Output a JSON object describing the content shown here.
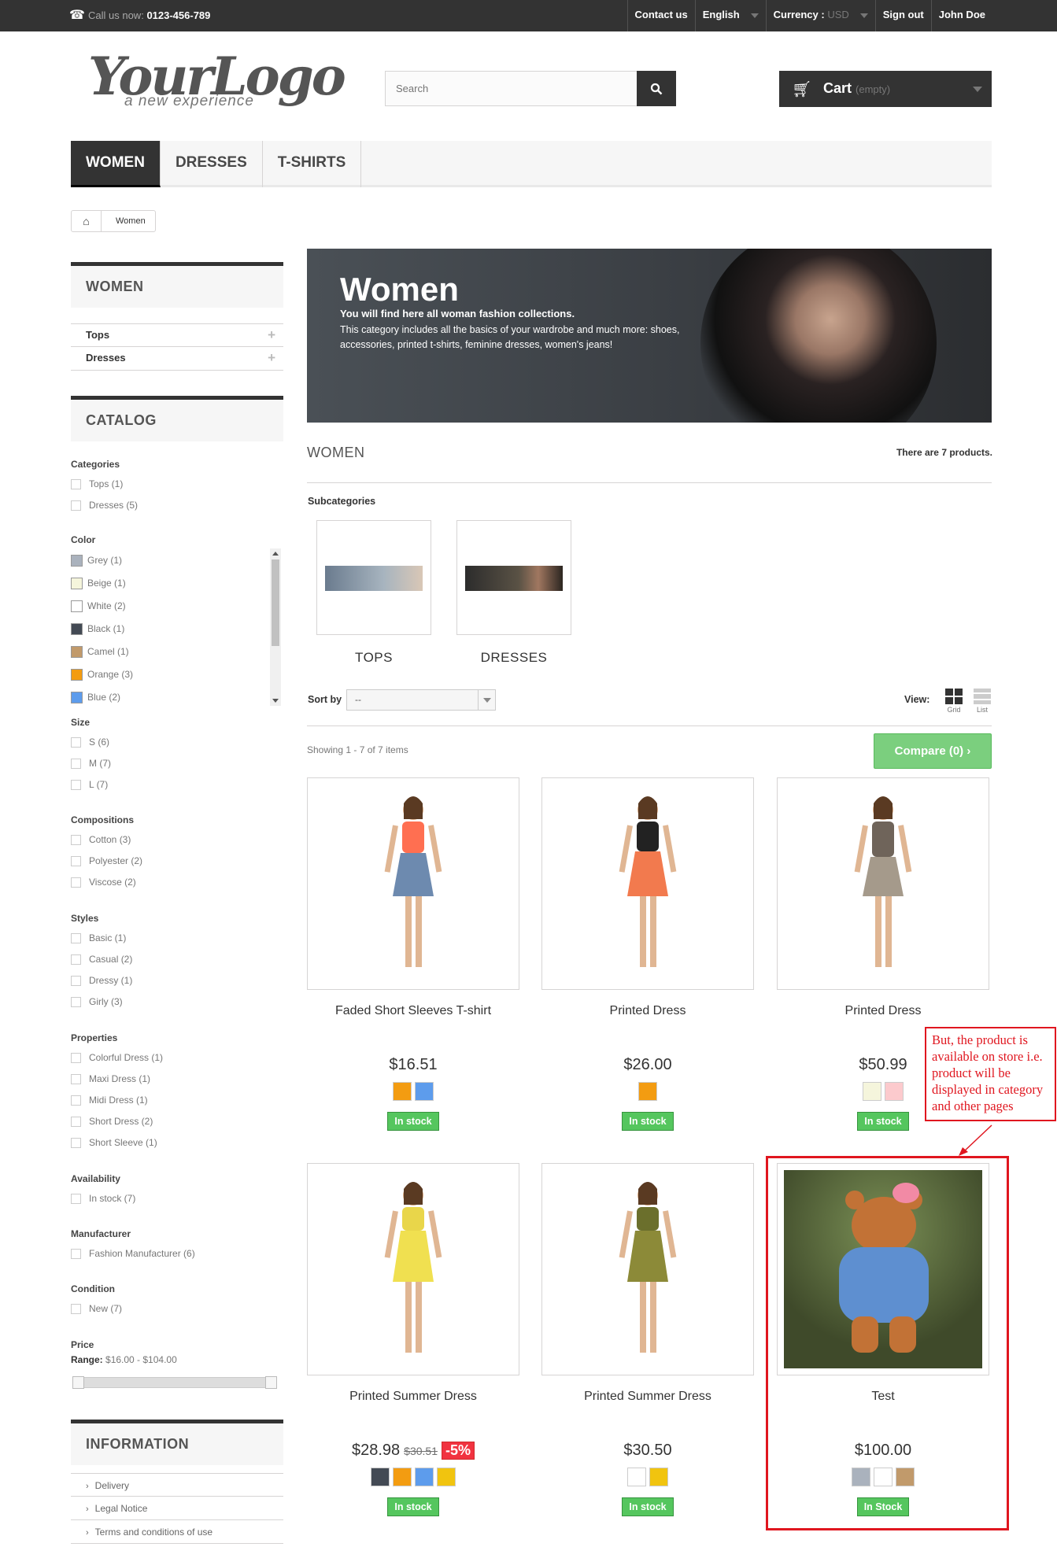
{
  "topbar": {
    "call_label": "Call us now:",
    "phone": "0123-456-789",
    "links": [
      "Contact us",
      "English",
      "Currency :",
      "Sign out",
      "John Doe"
    ],
    "currency_value": "USD"
  },
  "logo": {
    "main": "YourLogo",
    "tagline": "a new experience"
  },
  "search": {
    "placeholder": "Search"
  },
  "cart": {
    "label": "Cart",
    "status": "(empty)"
  },
  "menu": [
    "WOMEN",
    "DRESSES",
    "T-SHIRTS"
  ],
  "breadcrumb": {
    "current": "Women"
  },
  "left": {
    "category_block_title": "WOMEN",
    "category_items": [
      "Tops",
      "Dresses"
    ],
    "catalog_title": "CATALOG",
    "filters": {
      "categories": {
        "title": "Categories",
        "items": [
          "Tops (1)",
          "Dresses (5)"
        ]
      },
      "color": {
        "title": "Color",
        "items": [
          {
            "label": "Grey (1)",
            "color": "#AAB2BD"
          },
          {
            "label": "Beige (1)",
            "color": "#f5f5dc"
          },
          {
            "label": "White (2)",
            "color": "#ffffff"
          },
          {
            "label": "Black (1)",
            "color": "#434A54"
          },
          {
            "label": "Camel (1)",
            "color": "#C19A6B"
          },
          {
            "label": "Orange (3)",
            "color": "#F39C11"
          },
          {
            "label": "Blue (2)",
            "color": "#5D9CEC"
          }
        ]
      },
      "size": {
        "title": "Size",
        "items": [
          "S (6)",
          "M (7)",
          "L (7)"
        ]
      },
      "compositions": {
        "title": "Compositions",
        "items": [
          "Cotton (3)",
          "Polyester (2)",
          "Viscose (2)"
        ]
      },
      "styles": {
        "title": "Styles",
        "items": [
          "Basic (1)",
          "Casual (2)",
          "Dressy (1)",
          "Girly (3)"
        ]
      },
      "properties": {
        "title": "Properties",
        "items": [
          "Colorful Dress (1)",
          "Maxi Dress (1)",
          "Midi Dress (1)",
          "Short Dress (2)",
          "Short Sleeve (1)"
        ]
      },
      "availability": {
        "title": "Availability",
        "items": [
          "In stock (7)"
        ]
      },
      "manufacturer": {
        "title": "Manufacturer",
        "items": [
          "Fashion Manufacturer (6)"
        ]
      },
      "condition": {
        "title": "Condition",
        "items": [
          "New (7)"
        ]
      },
      "price": {
        "title": "Price",
        "range_label": "Range:",
        "range_value": "$16.00 - $104.00"
      }
    },
    "info_title": "INFORMATION",
    "info_items": [
      "Delivery",
      "Legal Notice",
      "Terms and conditions of use"
    ]
  },
  "banner": {
    "title": "Women",
    "line1": "You will find here all woman fashion collections.",
    "line2": "This category includes all the basics of your wardrobe and much more: shoes, accessories, printed t-shirts, feminine dresses, women's jeans!"
  },
  "category": {
    "heading": "WOMEN",
    "count": "There are 7 products.",
    "subcategories_title": "Subcategories",
    "subcategories": [
      "TOPS",
      "DRESSES"
    ],
    "sort_label": "Sort by",
    "sort_value": "--",
    "view_label": "View:",
    "view_grid": "Grid",
    "view_list": "List",
    "showing": "Showing 1 - 7 of 7 items",
    "compare": "Compare (0)"
  },
  "products": [
    {
      "name": "Faded Short Sleeves T-shirt",
      "price": "$16.51",
      "old_price": "",
      "discount": "",
      "colors": [
        "#F39C11",
        "#5D9CEC"
      ],
      "stock": "In stock"
    },
    {
      "name": "Printed Dress",
      "price": "$26.00",
      "old_price": "",
      "discount": "",
      "colors": [
        "#F39C11"
      ],
      "stock": "In stock"
    },
    {
      "name": "Printed Dress",
      "price": "$50.99",
      "old_price": "",
      "discount": "",
      "colors": [
        "#f5f5dc",
        "#FCCACD"
      ],
      "stock": "In stock"
    },
    {
      "name": "Printed Summer Dress",
      "price": "$28.98",
      "old_price": "$30.51",
      "discount": "-5%",
      "colors": [
        "#434A54",
        "#F39C11",
        "#5D9CEC",
        "#F1C40F"
      ],
      "stock": "In stock"
    },
    {
      "name": "Printed Summer Dress",
      "price": "$30.50",
      "old_price": "",
      "discount": "",
      "colors": [
        "#ffffff",
        "#F1C40F"
      ],
      "stock": "In stock"
    },
    {
      "name": "Test",
      "price": "$100.00",
      "old_price": "",
      "discount": "",
      "colors": [
        "#AAB2BD",
        "#ffffff",
        "#C19A6B"
      ],
      "stock": "In Stock"
    }
  ],
  "annotation": {
    "text": "But, the product is available on store i.e. product will be displayed in category and other pages",
    "color": "#e0161f"
  }
}
